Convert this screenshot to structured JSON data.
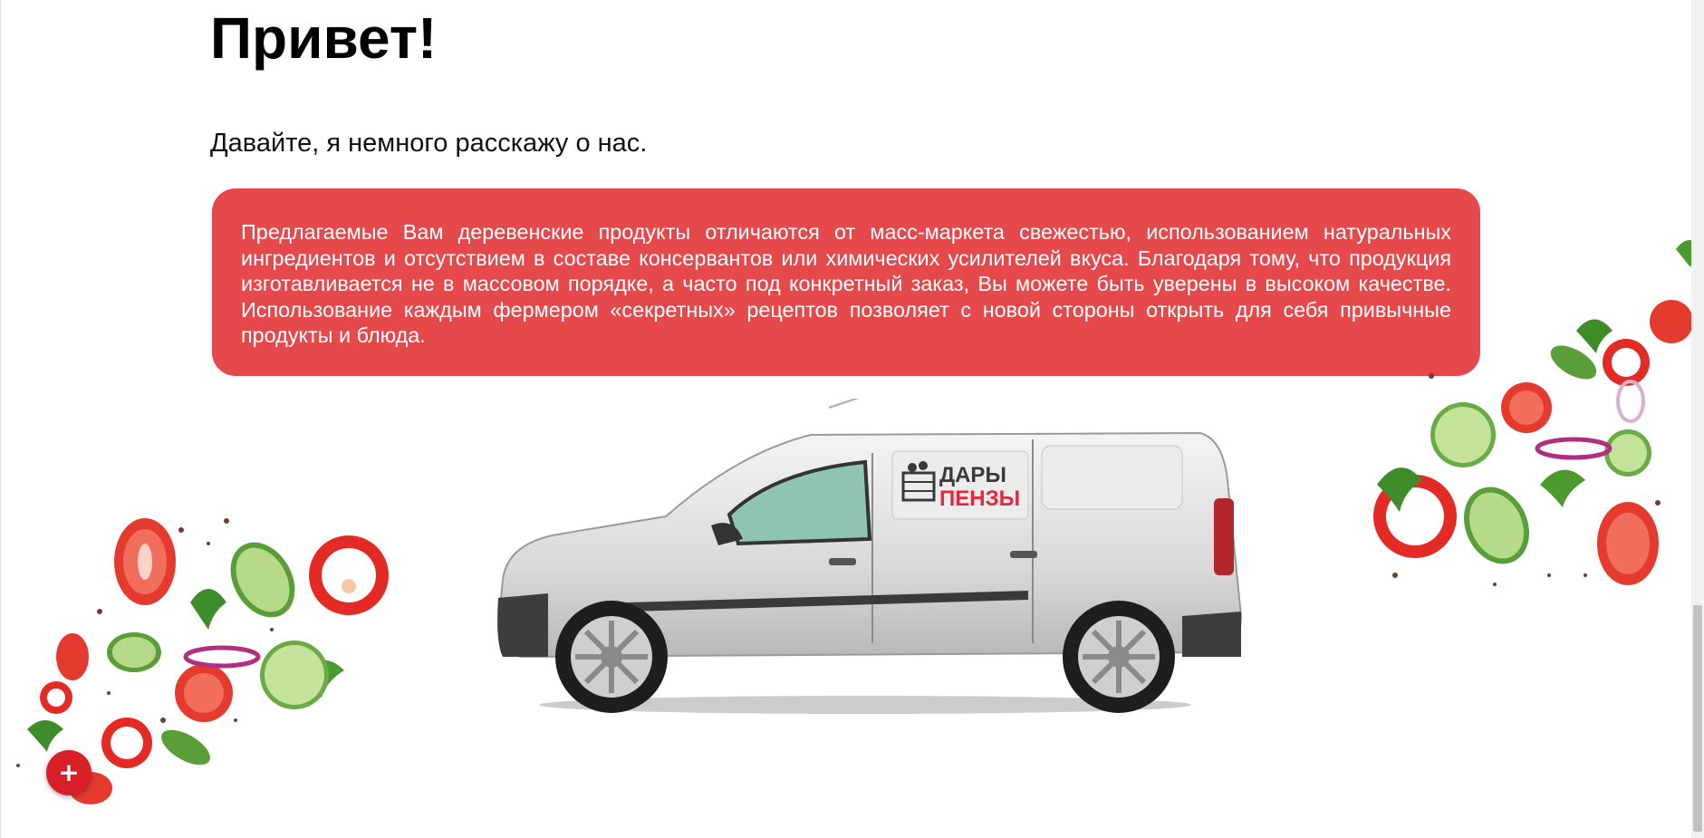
{
  "heading": {
    "title": "Привет!"
  },
  "intro": {
    "text": "Давайте, я немного расскажу о нас."
  },
  "about": {
    "paragraph": "Предлагаемые Вам деревенские продукты отличаются от масс-маркета свежестью, использованием натуральных ингредиентов и отсутствием в составе консервантов или химических усилителей вкуса. Благодаря тому, что продукция изготавливается не в массовом порядке, а часто под конкретный заказ, Вы можете быть уверены в высоком качестве. Использование каждым фермером «секретных» рецептов позволяет с новой стороны открыть для себя привычные продукты и блюда."
  },
  "van": {
    "logo_line1": "ДАРЫ",
    "logo_line2": "ПЕНЗЫ"
  },
  "fab": {
    "label": "+"
  },
  "colors": {
    "accent": "#e6494b",
    "fab": "#d61f26",
    "logo_red": "#e6283a",
    "logo_dark": "#3a3a3a"
  }
}
